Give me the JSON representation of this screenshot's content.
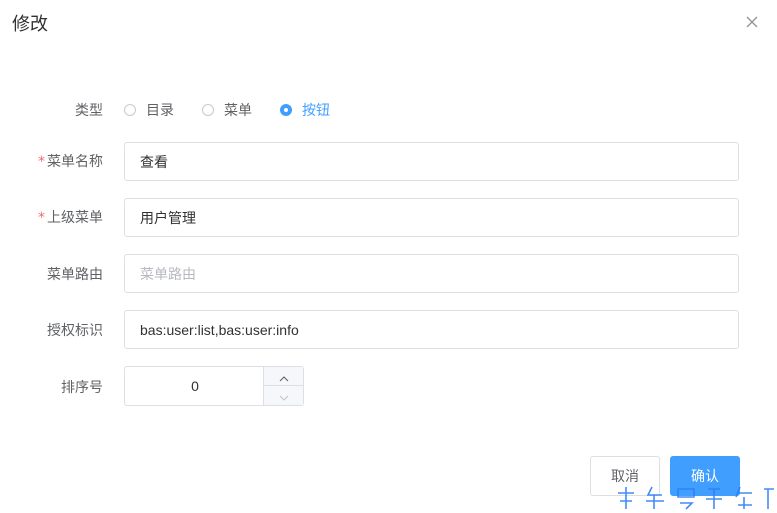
{
  "dialog": {
    "title": "修改"
  },
  "form": {
    "type": {
      "label": "类型",
      "options": [
        "目录",
        "菜单",
        "按钮"
      ],
      "selected_index": 2
    },
    "menu_name": {
      "required_mark": "*",
      "label": "菜单名称",
      "value": "查看"
    },
    "parent_menu": {
      "required_mark": "*",
      "label": "上级菜单",
      "value": "用户管理"
    },
    "menu_route": {
      "label": "菜单路由",
      "value": "",
      "placeholder": "菜单路由"
    },
    "permission": {
      "label": "授权标识",
      "value": "bas:user:list,bas:user:info"
    },
    "sort_order": {
      "label": "排序号",
      "value": "0"
    }
  },
  "footer": {
    "cancel_label": "取消",
    "confirm_label": "确认"
  },
  "colors": {
    "primary": "#409eff",
    "required": "#f56c6c",
    "border": "#dcdfe6"
  },
  "icons": {
    "close": "close-icon",
    "increase": "chevron-up-icon",
    "decrease": "chevron-down-icon"
  }
}
